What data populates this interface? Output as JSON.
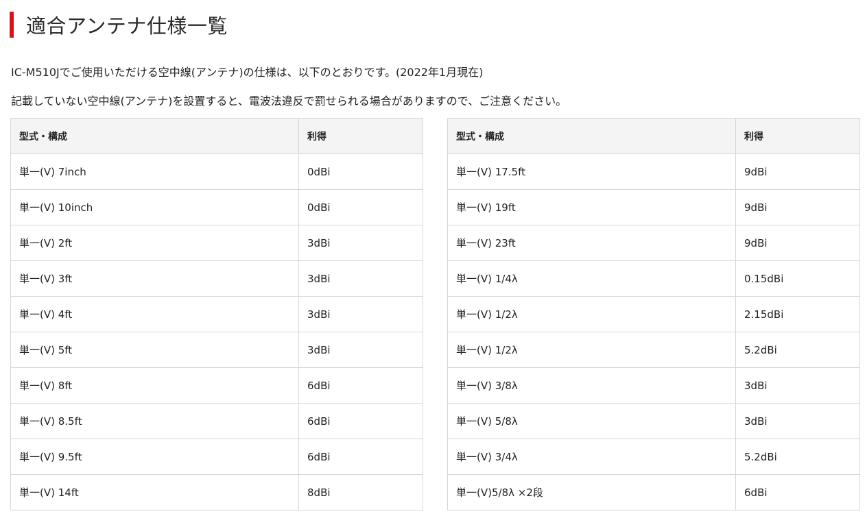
{
  "heading": {
    "title": "適合アンテナ仕様一覧",
    "accent_color": "#d7141a"
  },
  "intro": {
    "line1": "IC-M510Jでご使用いただける空中線(アンテナ)の仕様は、以下のとおりです。(2022年1月現在)",
    "line2": "記載していない空中線(アンテナ)を設置すると、電波法違反で罰せられる場合がありますので、ご注意ください。"
  },
  "tables": [
    {
      "headers": [
        "型式・構成",
        "利得"
      ],
      "rows": [
        [
          "単一(V) 7inch",
          "0dBi"
        ],
        [
          "単一(V) 10inch",
          "0dBi"
        ],
        [
          "単一(V) 2ft",
          "3dBi"
        ],
        [
          "単一(V) 3ft",
          "3dBi"
        ],
        [
          "単一(V) 4ft",
          "3dBi"
        ],
        [
          "単一(V) 5ft",
          "3dBi"
        ],
        [
          "単一(V) 8ft",
          "6dBi"
        ],
        [
          "単一(V) 8.5ft",
          "6dBi"
        ],
        [
          "単一(V) 9.5ft",
          "6dBi"
        ],
        [
          "単一(V) 14ft",
          "8dBi"
        ]
      ]
    },
    {
      "headers": [
        "型式・構成",
        "利得"
      ],
      "rows": [
        [
          "単一(V) 17.5ft",
          "9dBi"
        ],
        [
          "単一(V) 19ft",
          "9dBi"
        ],
        [
          "単一(V) 23ft",
          "9dBi"
        ],
        [
          "単一(V) 1/4λ",
          "0.15dBi"
        ],
        [
          "単一(V) 1/2λ",
          "2.15dBi"
        ],
        [
          "単一(V) 1/2λ",
          "5.2dBi"
        ],
        [
          "単一(V) 3/8λ",
          "3dBi"
        ],
        [
          "単一(V) 5/8λ",
          "3dBi"
        ],
        [
          "単一(V) 3/4λ",
          "5.2dBi"
        ],
        [
          "単一(V)5/8λ ×2段",
          "6dBi"
        ]
      ]
    }
  ]
}
